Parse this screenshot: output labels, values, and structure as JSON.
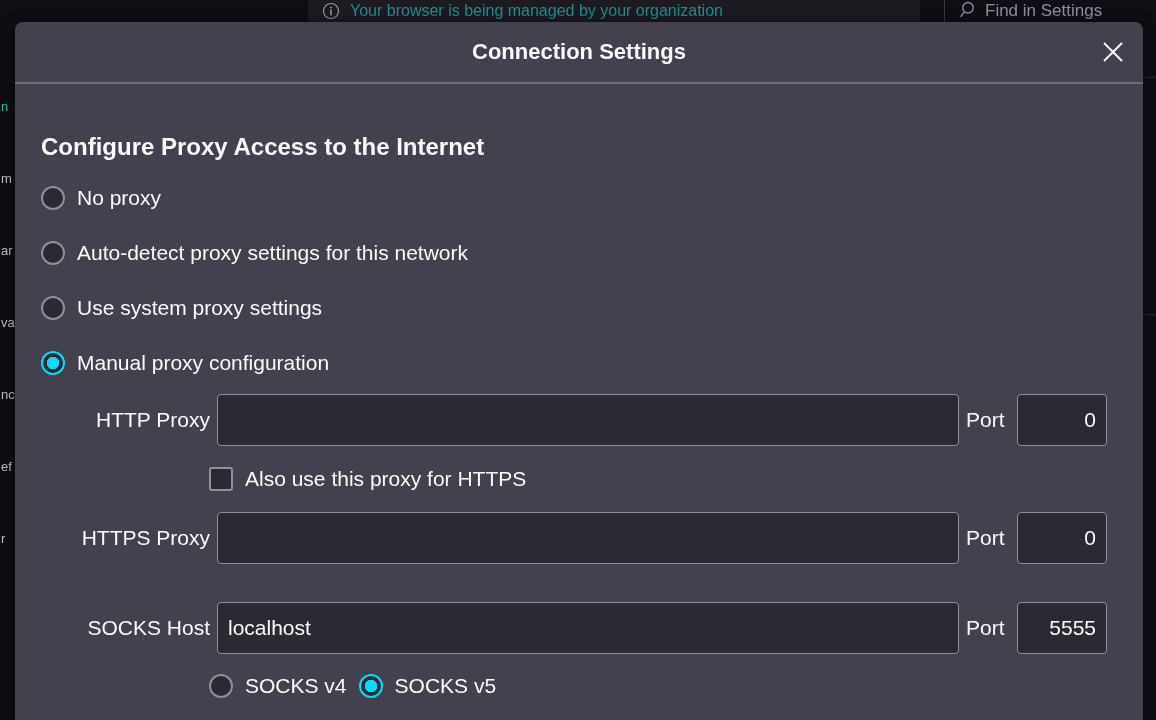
{
  "background": {
    "sidebar": [
      {
        "label": "n",
        "selected": true
      },
      {
        "label": "m",
        "selected": false
      },
      {
        "label": "ar",
        "selected": false
      },
      {
        "label": "va",
        "selected": false
      },
      {
        "label": "nc",
        "selected": false
      },
      {
        "label": "ef",
        "selected": false
      },
      {
        "label": "r",
        "selected": false
      }
    ],
    "banner": "Your browser is being managed by your organization",
    "search": {
      "placeholder": "Find in Settings"
    }
  },
  "dialog": {
    "title": "Connection Settings",
    "heading": "Configure Proxy Access to the Internet",
    "modes": [
      {
        "label": "No proxy",
        "selected": false
      },
      {
        "label": "Auto-detect proxy settings for this network",
        "selected": false
      },
      {
        "label": "Use system proxy settings",
        "selected": false
      },
      {
        "label": "Manual proxy configuration",
        "selected": true
      }
    ],
    "http": {
      "label": "HTTP Proxy",
      "port_label": "Port",
      "port": "0"
    },
    "https_checkbox": {
      "label": "Also use this proxy for HTTPS",
      "checked": false
    },
    "https": {
      "label": "HTTPS Proxy",
      "port_label": "Port",
      "port": "0"
    },
    "socks": {
      "label": "SOCKS Host",
      "value": "localhost",
      "port_label": "Port",
      "port": "5555"
    },
    "socks_versions": [
      {
        "label": "SOCKS v4",
        "selected": false
      },
      {
        "label": "SOCKS v5",
        "selected": true
      }
    ]
  }
}
